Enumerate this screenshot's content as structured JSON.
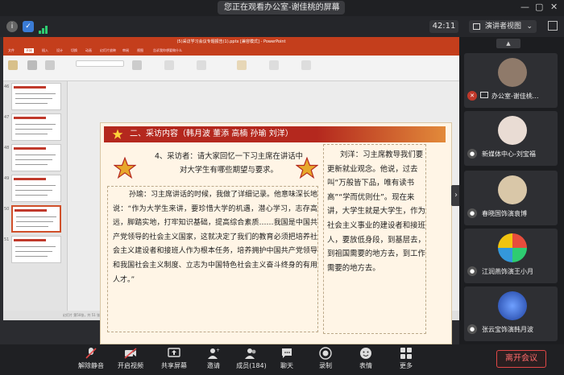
{
  "window": {
    "title": "您正在观看办公室-谢佳桃的屏幕",
    "chevron": "⌄",
    "min": "—",
    "max": "▢",
    "close": "✕"
  },
  "infobar": {
    "time": "42:11",
    "view_label": "演讲者视图",
    "view_chevron": "⌄"
  },
  "ppt": {
    "title_bar": "(5)采访学习会议专题报告(1).pptx [兼容模式] - PowerPoint",
    "tabs": [
      "文件",
      "开始",
      "插入",
      "设计",
      "切换",
      "动画",
      "幻灯片放映",
      "审阅",
      "视图",
      "告诉我你想要做什么"
    ],
    "slide_numbers": [
      "46",
      "47",
      "48",
      "49",
      "50",
      "51"
    ],
    "status": "幻灯片 第50张，共 51 张    中文(中国)"
  },
  "slide": {
    "heading": "二、采访内容（韩月波 董添 高楠 孙瑜 刘洋）",
    "question": "4、采访者：请大家回忆一下习主席在讲话中对大学生有哪些期望与要求。",
    "left_text": "孙瑜：习主席讲话的时候，我做了详细记录。他意味深长地说：“作为大学生来讲，要珍惜大学的机遇，潜心学习，志存高远，脚踏实地，打牢知识基础，提高综合素质……我国是中国共产党领导的社会主义国家，这就决定了我们的教育必须把培养社会主义建设者和接班人作为根本任务，培养拥护中国共产党领导和我国社会主义制度、立志为中国特色社会主义奋斗终身的有用人才。”",
    "right_text": "刘洋：习主席教导我们要更新就业观念。他说，过去叫“万般皆下品，唯有读书高”“学而优则仕”。现在来讲，大学生就是大学生，作为社会主义事业的建设者和接班人，要放低身段，到基层去，到祖国需要的地方去，到工作需要的地方去。"
  },
  "participants": [
    {
      "name": "办公室-谢佳桃...",
      "avatar_color": "#8f7a6a"
    },
    {
      "name": "新媒体中心-刘宝福",
      "avatar_color": "#e9dcd4"
    },
    {
      "name": "春晓国饰演袁博",
      "avatar_color": "#d9c7a8"
    },
    {
      "name": "江润燕饰演王小月",
      "avatar_color": "#5cb85c"
    },
    {
      "name": "张云宝饰演韩月波",
      "avatar_color": "#2f5db8"
    }
  ],
  "toolbar": {
    "unmute": "解除静音",
    "video": "开启视频",
    "share": "共享屏幕",
    "invite": "邀请",
    "members": "成员(184)",
    "chat": "聊天",
    "record": "录制",
    "reaction": "表情",
    "more": "更多",
    "leave": "离开会议"
  },
  "colors": {
    "accent_red": "#b4281e",
    "ppt_red": "#c43e1c",
    "leave_red": "#e04747"
  }
}
